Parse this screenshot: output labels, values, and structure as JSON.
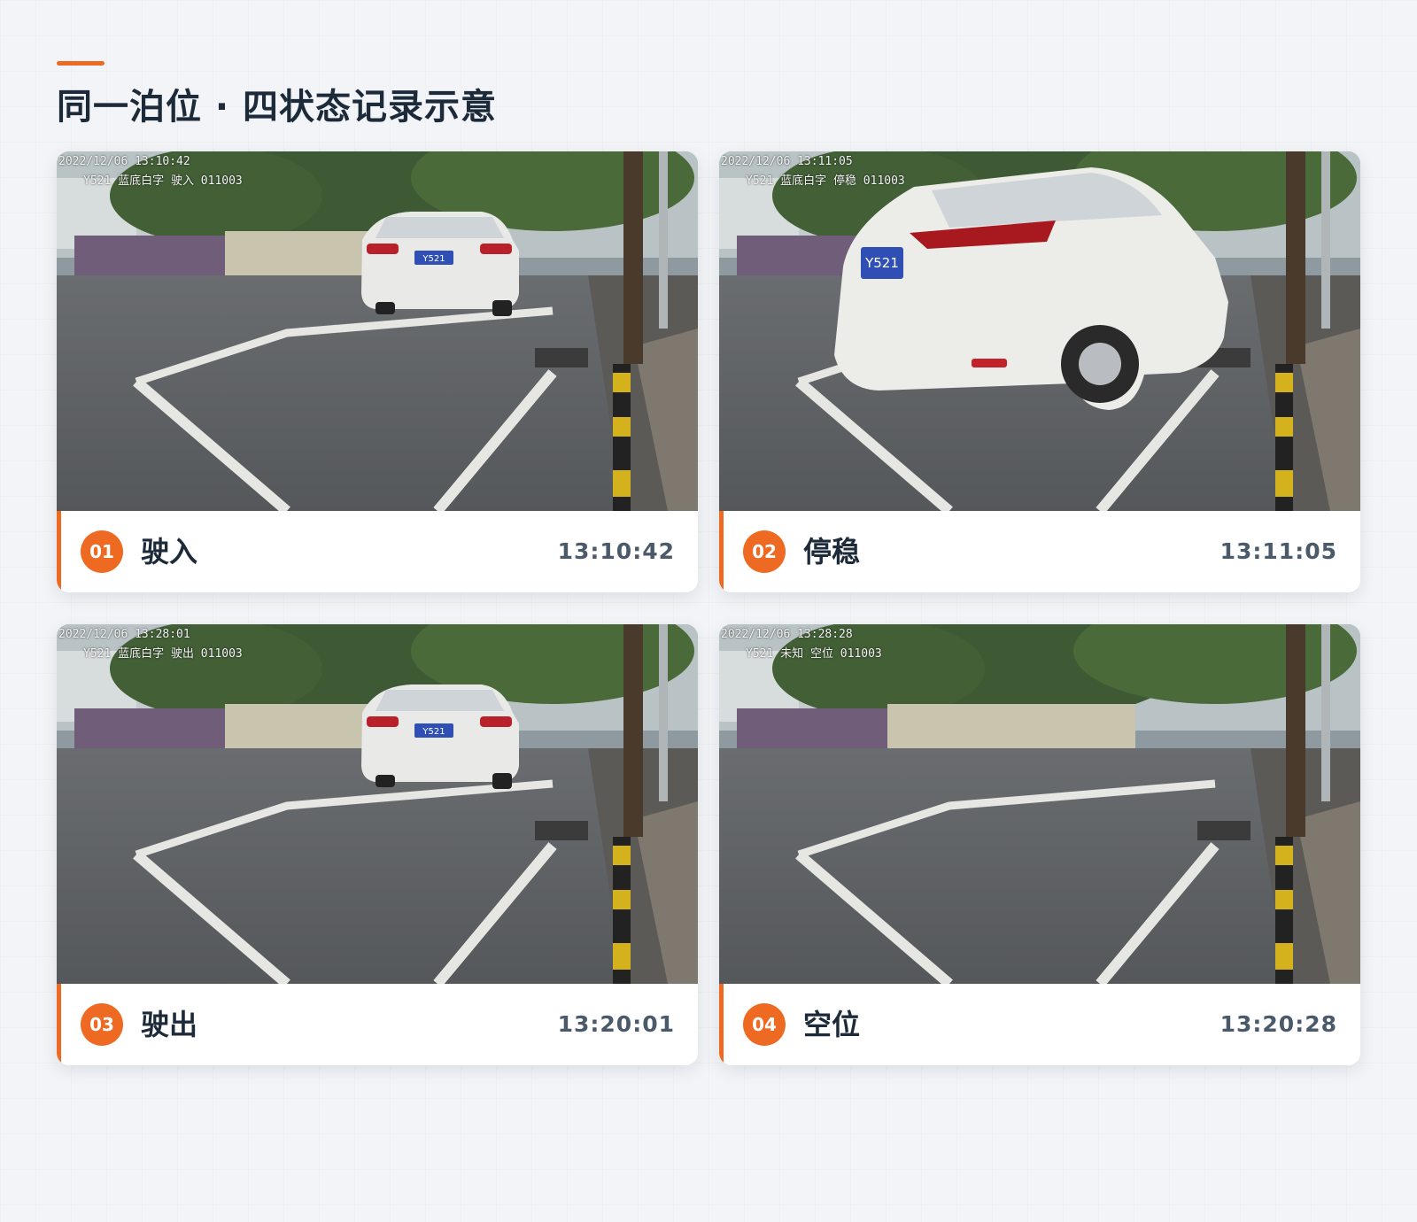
{
  "page": {
    "title": "同一泊位 · 四状态记录示意"
  },
  "records": [
    {
      "number": "01",
      "state": "驶入",
      "time": "13:10:42",
      "osd_timestamp": "2022/12/06 13:10:42",
      "osd_info": "Y521 蓝底白字 驶入 011003",
      "plate": "Y521",
      "car": "entering"
    },
    {
      "number": "02",
      "state": "停稳",
      "time": "13:11:05",
      "osd_timestamp": "2022/12/06 13:11:05",
      "osd_info": "Y521 蓝底白字 停稳 011003",
      "plate": "Y521",
      "car": "parked"
    },
    {
      "number": "03",
      "state": "驶出",
      "time": "13:20:01",
      "osd_timestamp": "2022/12/06 13:28:01",
      "osd_info": "Y521 蓝底白字 驶出 011003",
      "plate": "Y521",
      "car": "leaving"
    },
    {
      "number": "04",
      "state": "空位",
      "time": "13:20:28",
      "osd_timestamp": "2022/12/06 13:28:28",
      "osd_info": "Y521 未知 空位 011003",
      "plate": "",
      "car": "none"
    }
  ],
  "colors": {
    "accent": "#ee6a22",
    "title": "#1c2a3a",
    "time": "#4a5a6a"
  }
}
